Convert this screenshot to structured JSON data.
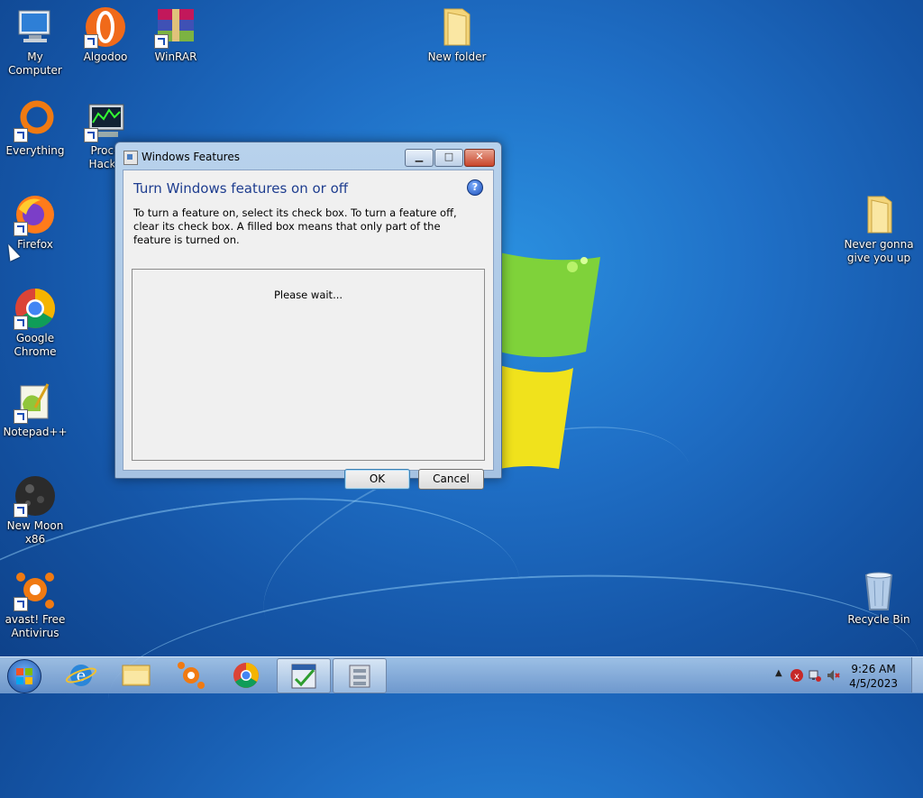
{
  "desktop": {
    "icons": [
      {
        "name": "my-computer",
        "label": "My Computer"
      },
      {
        "name": "algodoo",
        "label": "Algodoo"
      },
      {
        "name": "winrar",
        "label": "WinRAR"
      },
      {
        "name": "new-folder",
        "label": "New folder"
      },
      {
        "name": "everything",
        "label": "Everything"
      },
      {
        "name": "process-hacker",
        "label": "Proce\nHacke"
      },
      {
        "name": "firefox",
        "label": "Firefox"
      },
      {
        "name": "google-chrome",
        "label": "Google\nChrome"
      },
      {
        "name": "notepad-plus-plus",
        "label": "Notepad++"
      },
      {
        "name": "new-moon",
        "label": "New Moon\nx86"
      },
      {
        "name": "avast",
        "label": "avast! Free\nAntivirus"
      },
      {
        "name": "never-gonna-folder",
        "label": "Never gonna\ngive you up"
      },
      {
        "name": "recycle-bin",
        "label": "Recycle Bin"
      }
    ]
  },
  "dialog": {
    "title": "Windows Features",
    "heading": "Turn Windows features on or off",
    "description": "To turn a feature on, select its check box. To turn a feature off, clear its check box. A filled box means that only part of the feature is turned on.",
    "status": "Please wait...",
    "ok_label": "OK",
    "cancel_label": "Cancel"
  },
  "taskbar": {
    "time": "9:26 AM",
    "date": "4/5/2023"
  }
}
